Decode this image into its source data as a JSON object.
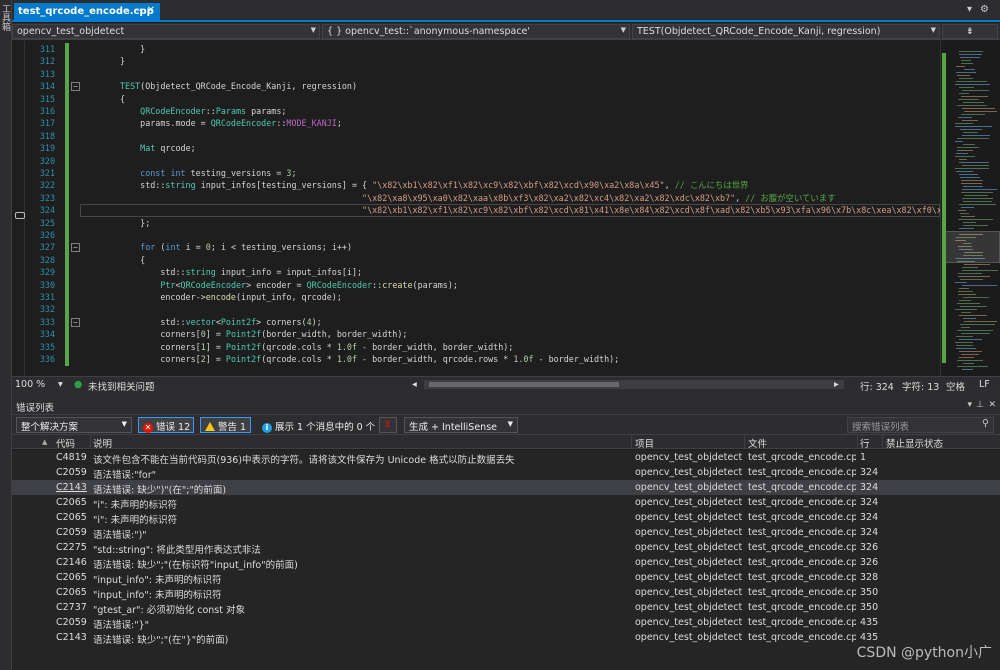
{
  "window": {
    "side_label": "工具箱"
  },
  "tab": {
    "title": "test_qrcode_encode.cpp",
    "pin": "⊸",
    "close": "✕"
  },
  "tabbar_icons": {
    "dropdown": "▾",
    "settings": "⚙"
  },
  "nav": {
    "project": "opencv_test_objdetect",
    "scope": "{ } opencv_test::`anonymous-namespace'",
    "member": "TEST(Objdetect_QRCode_Encode_Kanji, regression)"
  },
  "code_lines": [
    {
      "n": "311",
      "html": "<span>    }</span>",
      "chg": true
    },
    {
      "n": "312",
      "html": "<span>}</span>",
      "chg": true
    },
    {
      "n": "313",
      "html": "",
      "chg": true
    },
    {
      "n": "314",
      "html": "<span class='t'>TEST</span>(Objdetect_QRCode_Encode_Kanji, regression)",
      "chg": true,
      "col": true
    },
    {
      "n": "315",
      "html": "{",
      "chg": true
    },
    {
      "n": "316",
      "html": "    <span class='t'>QRCodeEncoder</span>::<span class='t'>Params</span> params;",
      "chg": true
    },
    {
      "n": "317",
      "html": "    params.mode = <span class='t'>QRCodeEncoder</span>::<span class='m'>MODE_KANJI</span>;",
      "chg": true
    },
    {
      "n": "318",
      "html": "",
      "chg": true
    },
    {
      "n": "319",
      "html": "    <span class='t'>Mat</span> qrcode;",
      "chg": true
    },
    {
      "n": "320",
      "html": "",
      "chg": true
    },
    {
      "n": "321",
      "html": "    <span class='k'>const</span> <span class='k'>int</span> testing_versions = <span class='n'>3</span>;",
      "chg": true
    },
    {
      "n": "322",
      "html": "    std::<span class='t'>string</span> input_infos[testing_versions] = { <span class='s'>\"\\x82\\xb1\\x82\\xf1\\x82\\xc9\\x82\\xbf\\x82\\xcd\\x90\\xa2\\x8a\\x45\"</span>, <span class='c'>// こんにちは世界</span>",
      "chg": true
    },
    {
      "n": "323",
      "html": "                                                <span class='s'>\"\\x82\\xa8\\x95\\xa0\\x82\\xaa\\x8b\\xf3\\x82\\xa2\\x82\\xc4\\x82\\xa2\\x82\\xdc\\x82\\xb7\"</span>, <span class='c'>// お腹が空いています</span>",
      "chg": true
    },
    {
      "n": "324",
      "html": "                                                <span class='s'>\"\\x82\\xb1\\x82\\xf1\\x82\\xc9\\x82\\xbf\\x82\\xcd\\x81\\x41\\x8e\\x84\\x82\\xcd\\x8f\\xad\\x82\\xb5\\x93\\xfa\\x96\\x7b\\x8c\\xea\\x82\\xf0\\x98</span>",
      "chg": true,
      "hl": true
    },
    {
      "n": "325",
      "html": "    };",
      "chg": true
    },
    {
      "n": "326",
      "html": "",
      "chg": true
    },
    {
      "n": "327",
      "html": "    <span class='k'>for</span> (<span class='k'>int</span> i = <span class='n'>0</span>; i &lt; testing_versions; i++)",
      "chg": true,
      "col": true
    },
    {
      "n": "328",
      "html": "    {",
      "chg": true
    },
    {
      "n": "329",
      "html": "        std::<span class='t'>string</span> input_info = input_infos[i];",
      "chg": true
    },
    {
      "n": "330",
      "html": "        <span class='t'>Ptr</span>&lt;<span class='t'>QRCodeEncoder</span>&gt; encoder = <span class='t'>QRCodeEncoder</span>::<span class='f'>create</span>(params);",
      "chg": true
    },
    {
      "n": "331",
      "html": "        encoder-&gt;<span class='f'>encode</span>(input_info, qrcode);",
      "chg": true
    },
    {
      "n": "332",
      "html": "",
      "chg": true
    },
    {
      "n": "333",
      "html": "        std::<span class='t'>vector</span>&lt;<span class='t'>Point2f</span>&gt; corners(<span class='n'>4</span>);",
      "chg": true,
      "col": true
    },
    {
      "n": "334",
      "html": "        corners[<span class='n'>0</span>] = <span class='t'>Point2f</span>(border_width, border_width);",
      "chg": true
    },
    {
      "n": "335",
      "html": "        corners[<span class='n'>1</span>] = <span class='t'>Point2f</span>(qrcode.cols * <span class='n'>1.0f</span> - border_width, border_width);",
      "chg": true
    },
    {
      "n": "336",
      "html": "        corners[<span class='n'>2</span>] = <span class='t'>Point2f</span>(qrcode.cols * <span class='n'>1.0f</span> - border_width, qrcode.rows * <span class='n'>1.0f</span> - border_width);",
      "chg": true
    }
  ],
  "status": {
    "zoom": "100 %",
    "issues": "未找到相关问题",
    "line": "行: 324",
    "col": "字符: 13",
    "tabs": "空格",
    "eol": "LF"
  },
  "errlist": {
    "title": "错误列表",
    "scope": "整个解决方案",
    "errors": "错误 12",
    "warnings": "警告 1",
    "messages": "展示 1 个消息中的 0 个",
    "build": "生成 + IntelliSense",
    "search_placeholder": "搜索错误列表",
    "headers": {
      "code": "代码",
      "desc": "说明",
      "project": "项目",
      "file": "文件",
      "line": "行",
      "suppress": "禁止显示状态"
    },
    "rows": [
      {
        "type": "warning",
        "code": "C4819",
        "desc": "该文件包含不能在当前代码页(936)中表示的字符。请将该文件保存为 Unicode 格式以防止数据丢失",
        "project": "opencv_test_objdetect",
        "file": "test_qrcode_encode.cpp",
        "line": "1"
      },
      {
        "type": "error",
        "code": "C2059",
        "desc": "语法错误:\"for\"",
        "project": "opencv_test_objdetect",
        "file": "test_qrcode_encode.cpp",
        "line": "324"
      },
      {
        "type": "error",
        "code": "C2143",
        "desc": "语法错误: 缺少\")\"(在\";\"的前面)",
        "project": "opencv_test_objdetect",
        "file": "test_qrcode_encode.cpp",
        "line": "324",
        "selected": true
      },
      {
        "type": "error",
        "code": "C2065",
        "desc": "\"i\": 未声明的标识符",
        "project": "opencv_test_objdetect",
        "file": "test_qrcode_encode.cpp",
        "line": "324"
      },
      {
        "type": "error",
        "code": "C2065",
        "desc": "\"i\": 未声明的标识符",
        "project": "opencv_test_objdetect",
        "file": "test_qrcode_encode.cpp",
        "line": "324"
      },
      {
        "type": "error",
        "code": "C2059",
        "desc": "语法错误:\")\"",
        "project": "opencv_test_objdetect",
        "file": "test_qrcode_encode.cpp",
        "line": "324"
      },
      {
        "type": "error",
        "code": "C2275",
        "desc": "\"std::string\": 将此类型用作表达式非法",
        "project": "opencv_test_objdetect",
        "file": "test_qrcode_encode.cpp",
        "line": "326"
      },
      {
        "type": "error",
        "code": "C2146",
        "desc": "语法错误: 缺少\";\"(在标识符\"input_info\"的前面)",
        "project": "opencv_test_objdetect",
        "file": "test_qrcode_encode.cpp",
        "line": "326"
      },
      {
        "type": "error",
        "code": "C2065",
        "desc": "\"input_info\": 未声明的标识符",
        "project": "opencv_test_objdetect",
        "file": "test_qrcode_encode.cpp",
        "line": "328"
      },
      {
        "type": "error",
        "code": "C2065",
        "desc": "\"input_info\": 未声明的标识符",
        "project": "opencv_test_objdetect",
        "file": "test_qrcode_encode.cpp",
        "line": "350"
      },
      {
        "type": "error",
        "code": "C2737",
        "desc": "\"gtest_ar\": 必须初始化 const 对象",
        "project": "opencv_test_objdetect",
        "file": "test_qrcode_encode.cpp",
        "line": "350"
      },
      {
        "type": "error",
        "code": "C2059",
        "desc": "语法错误:\"}\"",
        "project": "opencv_test_objdetect",
        "file": "test_qrcode_encode.cpp",
        "line": "435"
      },
      {
        "type": "error",
        "code": "C2143",
        "desc": "语法错误: 缺少\";\"(在\"}\"的前面)",
        "project": "opencv_test_objdetect",
        "file": "test_qrcode_encode.cpp",
        "line": "435"
      }
    ]
  },
  "watermark": "CSDN @python小广"
}
